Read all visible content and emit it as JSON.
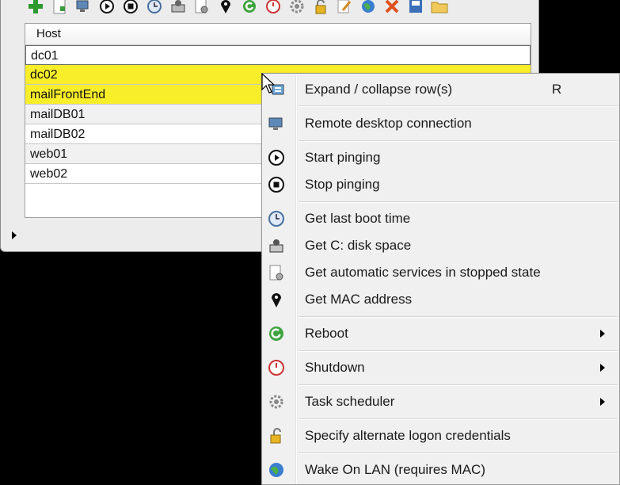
{
  "grid": {
    "header": "Host",
    "rows": [
      "dc01",
      "dc02",
      "mailFrontEnd",
      "mailDB01",
      "mailDB02",
      "web01",
      "web02"
    ]
  },
  "toolbar": {
    "icons": [
      "add-icon",
      "new-document-icon",
      "remote-desktop-icon",
      "play-icon",
      "stop-icon",
      "clock-icon",
      "disk-icon",
      "services-icon",
      "location-pin-icon",
      "reboot-icon",
      "shutdown-icon",
      "gear-icon",
      "lock-icon",
      "edit-icon",
      "globe-icon",
      "delete-icon",
      "save-icon",
      "folder-icon"
    ]
  },
  "menu": {
    "expand": {
      "label": "Expand / collapse row(s)",
      "shortcut": "R"
    },
    "rdp": {
      "label": "Remote desktop connection"
    },
    "start_ping": {
      "label": "Start pinging"
    },
    "stop_ping": {
      "label": "Stop pinging"
    },
    "boot_time": {
      "label": "Get last boot time"
    },
    "disk_space": {
      "label": "Get C: disk space"
    },
    "auto_services": {
      "label": "Get automatic services in stopped state"
    },
    "mac": {
      "label": "Get MAC address"
    },
    "reboot": {
      "label": "Reboot"
    },
    "shutdown": {
      "label": "Shutdown"
    },
    "scheduler": {
      "label": "Task scheduler"
    },
    "credentials": {
      "label": "Specify alternate logon credentials"
    },
    "wol": {
      "label": "Wake On LAN (requires MAC)"
    }
  },
  "colors": {
    "highlight": "#f8ee2a",
    "menu_bg": "#f0f0f0"
  }
}
